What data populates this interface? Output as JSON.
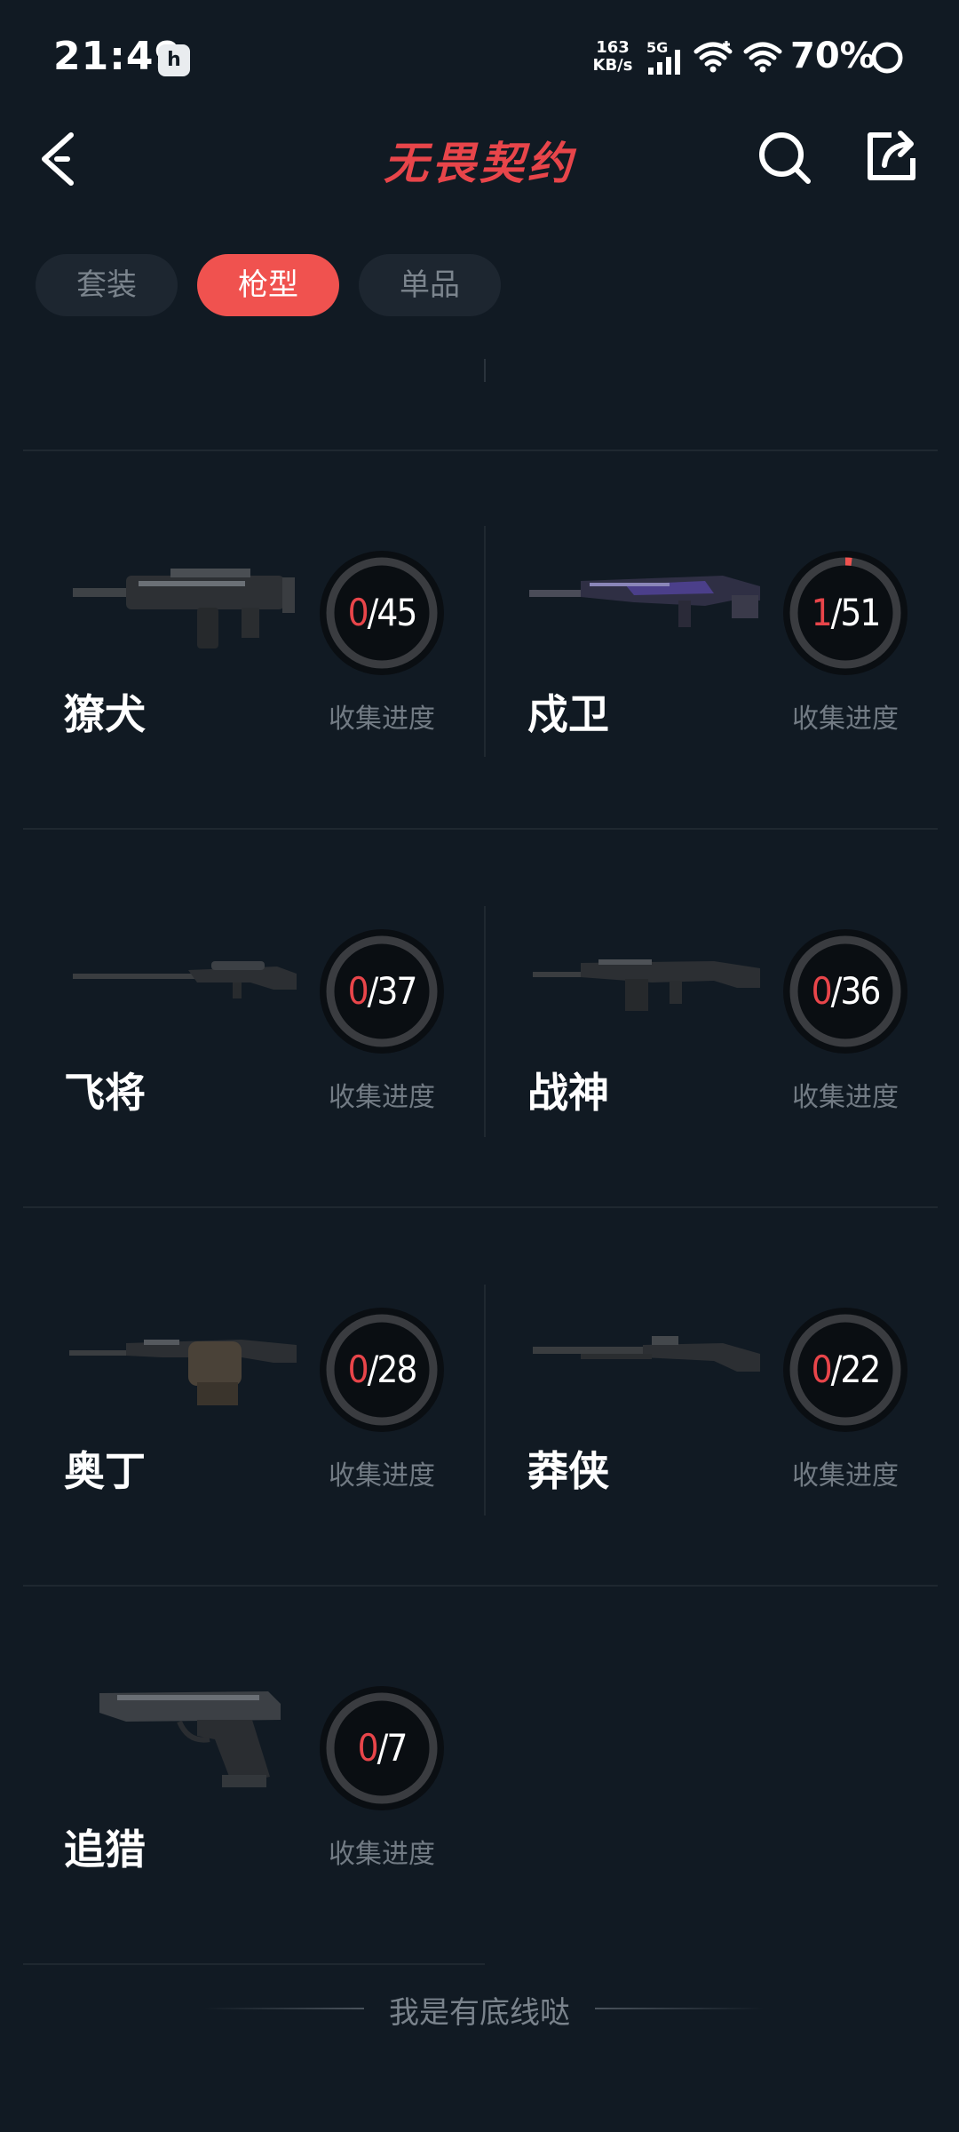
{
  "status_bar": {
    "time": "21:49",
    "app_icon": "h",
    "net_speed_value": "163",
    "net_speed_unit": "KB/s",
    "network": "5G",
    "battery": "70%"
  },
  "header": {
    "title": "无畏契约",
    "back_icon": "chevron-left-icon",
    "search_icon": "search-icon",
    "share_icon": "share-icon"
  },
  "tabs": [
    {
      "label": "套装",
      "active": false
    },
    {
      "label": "枪型",
      "active": true
    },
    {
      "label": "单品",
      "active": false
    }
  ],
  "weapons": [
    {
      "name": "獠犬",
      "collected": "0",
      "total": "/45",
      "progress": 0.0,
      "progress_label": "收集进度"
    },
    {
      "name": "戍卫",
      "collected": "1",
      "total": "/51",
      "progress": 0.0196,
      "progress_label": "收集进度"
    },
    {
      "name": "飞将",
      "collected": "0",
      "total": "/37",
      "progress": 0.0,
      "progress_label": "收集进度"
    },
    {
      "name": "战神",
      "collected": "0",
      "total": "/36",
      "progress": 0.0,
      "progress_label": "收集进度"
    },
    {
      "name": "奥丁",
      "collected": "0",
      "total": "/28",
      "progress": 0.0,
      "progress_label": "收集进度"
    },
    {
      "name": "莽侠",
      "collected": "0",
      "total": "/22",
      "progress": 0.0,
      "progress_label": "收集进度"
    },
    {
      "name": "追猎",
      "collected": "0",
      "total": "/7",
      "progress": 0.0,
      "progress_label": "收集进度"
    }
  ],
  "footer": {
    "text": "我是有底线哒"
  },
  "colors": {
    "accent": "#f0524f",
    "background": "#111a23"
  }
}
